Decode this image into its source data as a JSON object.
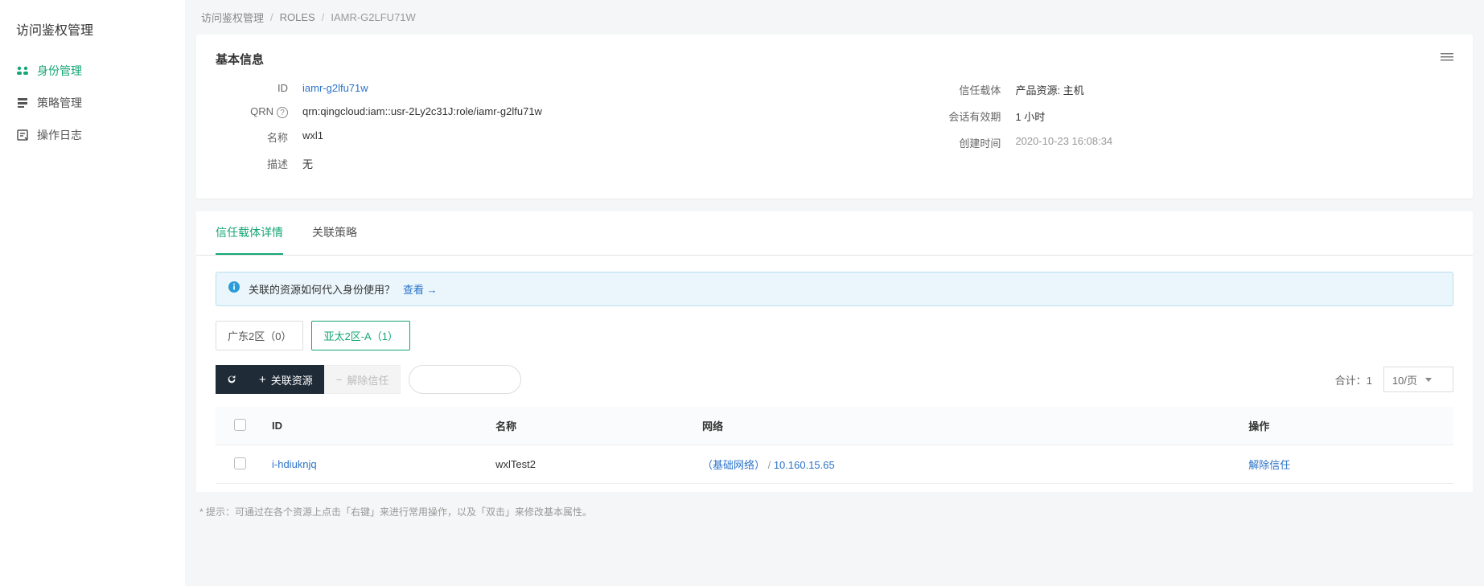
{
  "sidebar": {
    "title": "访问鉴权管理",
    "items": [
      {
        "label": "身份管理"
      },
      {
        "label": "策略管理"
      },
      {
        "label": "操作日志"
      }
    ]
  },
  "breadcrumb": {
    "root": "访问鉴权管理",
    "section": "ROLES",
    "current": "IAMR-G2LFU71W"
  },
  "basic": {
    "title": "基本信息",
    "labels": {
      "id": "ID",
      "qrn": "QRN",
      "name": "名称",
      "desc": "描述",
      "trust": "信任载体",
      "session": "会话有效期",
      "created": "创建时间"
    },
    "values": {
      "id": "iamr-g2lfu71w",
      "qrn": "qrn:qingcloud:iam::usr-2Ly2c31J:role/iamr-g2lfu71w",
      "name": "wxl1",
      "desc": "无",
      "trust": "产品资源: 主机",
      "session": "1 小时",
      "created": "2020-10-23 16:08:34"
    }
  },
  "tabs": {
    "trust": "信任载体详情",
    "policy": "关联策略"
  },
  "banner": {
    "text": "关联的资源如何代入身份使用？",
    "link": "查看 →"
  },
  "regions": [
    {
      "label": "广东2区（0）",
      "active": false
    },
    {
      "label": "亚太2区-A（1）",
      "active": true
    }
  ],
  "toolbar": {
    "assoc": "关联资源",
    "unassoc": "解除信任",
    "total_label": "合计：",
    "total": "1",
    "page_size": "10/页"
  },
  "table": {
    "headers": {
      "id": "ID",
      "name": "名称",
      "net": "网络",
      "action": "操作"
    },
    "rows": [
      {
        "id": "i-hdiuknjq",
        "name": "wxlTest2",
        "net_label": "（基础网络）",
        "net_sep": " / ",
        "net_ip": "10.160.15.65",
        "action": "解除信任"
      }
    ]
  },
  "footnote": "* 提示：可通过在各个资源上点击「右键」来进行常用操作，以及「双击」来修改基本属性。"
}
